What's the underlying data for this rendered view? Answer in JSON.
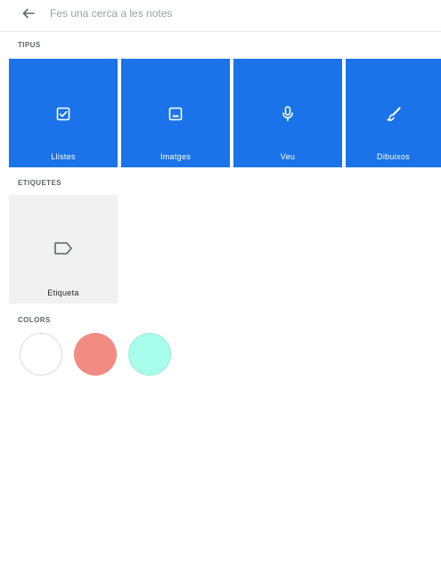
{
  "search": {
    "placeholder": "Fes una cerca a les notes",
    "value": ""
  },
  "sections": {
    "types_title": "TIPUS",
    "labels_title": "ETIQUETES",
    "colors_title": "COLORS"
  },
  "types": [
    {
      "label": "Llistes",
      "icon": "checkbox-icon"
    },
    {
      "label": "Imatges",
      "icon": "image-icon"
    },
    {
      "label": "Veu",
      "icon": "microphone-icon"
    },
    {
      "label": "Dibuixos",
      "icon": "brush-icon"
    }
  ],
  "labels": [
    {
      "label": "Etiqueta",
      "icon": "label-icon"
    }
  ],
  "colors": [
    {
      "name": "default",
      "hex": "#ffffff",
      "border": "#dadce0"
    },
    {
      "name": "red",
      "hex": "#f28b82",
      "border": "#f28b82"
    },
    {
      "name": "teal",
      "hex": "#a7ffeb",
      "border": "#9ee9d8"
    }
  ],
  "theme": {
    "accent": "#1a73e8"
  }
}
